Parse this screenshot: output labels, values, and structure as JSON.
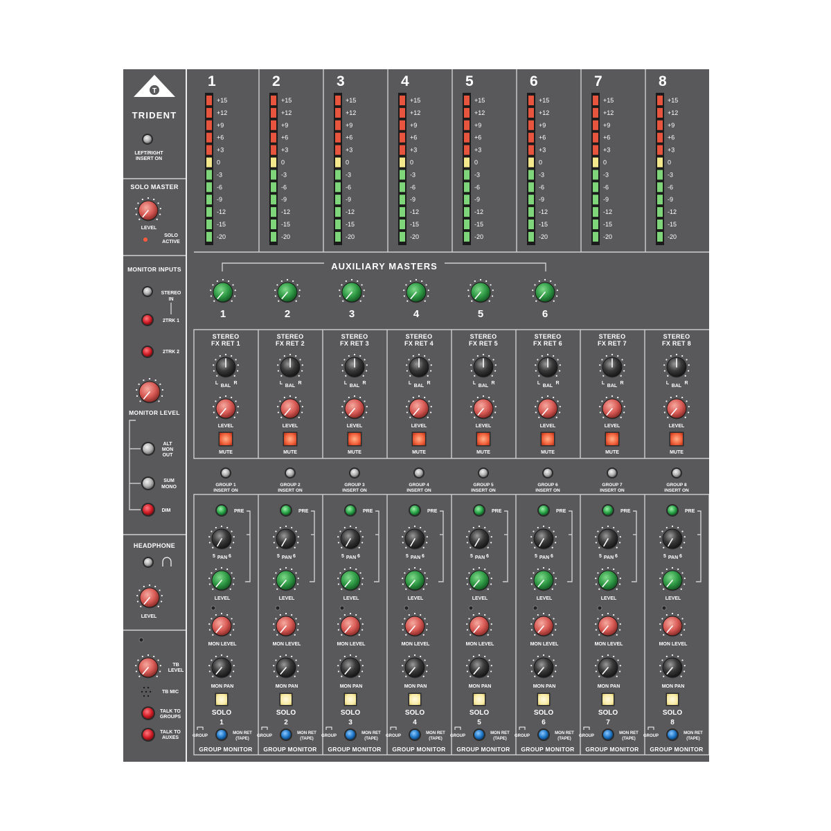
{
  "brand": {
    "name": "TRIDENT"
  },
  "master": {
    "insert_label_1": "LEFT/RIGHT",
    "insert_label_2": "INSERT ON",
    "solo_master": "SOLO MASTER",
    "level": "LEVEL",
    "solo_active_1": "SOLO",
    "solo_active_2": "ACTIVE",
    "monitor_inputs": "MONITOR INPUTS",
    "stereo_in_1": "STEREO",
    "stereo_in_2": "IN",
    "trk1": "2TRK 1",
    "trk2": "2TRK 2",
    "monitor_level": "MONITOR LEVEL",
    "alt_1": "ALT",
    "alt_2": "MON",
    "alt_3": "OUT",
    "sum_1": "SUM",
    "sum_2": "MONO",
    "dim": "DIM",
    "headphone": "HEADPHONE",
    "hp_level": "LEVEL",
    "tb_level_1": "TB",
    "tb_level_2": "LEVEL",
    "tb_mic": "TB MIC",
    "talk_groups_1": "TALK TO",
    "talk_groups_2": "GROUPS",
    "talk_auxes_1": "TALK TO",
    "talk_auxes_2": "AUXES"
  },
  "meters": {
    "scale": [
      "+15",
      "+12",
      "+9",
      "+6",
      "+3",
      "0",
      "-3",
      "-6",
      "-9",
      "-12",
      "-15",
      "-20"
    ],
    "segment_colors": [
      "red",
      "red",
      "red",
      "red",
      "red",
      "yellow",
      "green",
      "green",
      "green",
      "green",
      "green",
      "green"
    ]
  },
  "aux": {
    "title": "AUXILIARY MASTERS",
    "knobs": [
      "1",
      "2",
      "3",
      "4",
      "5",
      "6"
    ]
  },
  "labels": {
    "bal": "BAL",
    "bal_l": "L",
    "bal_r": "R",
    "level": "LEVEL",
    "mute": "MUTE",
    "pre": "PRE",
    "pan": "PAN",
    "mon_level": "MON LEVEL",
    "mon_pan": "MON PAN",
    "solo": "SOLO",
    "group": "GROUP",
    "mon_ret_1": "MON RET",
    "mon_ret_2": "(TAPE)",
    "group_monitor": "GROUP MONITOR",
    "insert_on": "INSERT ON"
  },
  "channels": [
    {
      "num": "1",
      "fx_1": "STEREO",
      "fx_2": "FX RET 1",
      "insert": "GROUP 1",
      "pan_l": "5",
      "pan_r": "6"
    },
    {
      "num": "2",
      "fx_1": "STEREO",
      "fx_2": "FX RET 2",
      "insert": "GROUP 2",
      "pan_l": "5",
      "pan_r": "6"
    },
    {
      "num": "3",
      "fx_1": "STEREO",
      "fx_2": "FX RET 3",
      "insert": "GROUP 3",
      "pan_l": "5",
      "pan_r": "6"
    },
    {
      "num": "4",
      "fx_1": "STEREO",
      "fx_2": "FX RET 4",
      "insert": "GROUP 4",
      "pan_l": "5",
      "pan_r": "6"
    },
    {
      "num": "5",
      "fx_1": "STEREO",
      "fx_2": "FX RET 5",
      "insert": "GROUP 5",
      "pan_l": "5",
      "pan_r": "6"
    },
    {
      "num": "6",
      "fx_1": "STEREO",
      "fx_2": "FX RET 6",
      "insert": "GROUP 6",
      "pan_l": "5",
      "pan_r": "6"
    },
    {
      "num": "7",
      "fx_1": "STEREO",
      "fx_2": "FX RET 7",
      "insert": "GROUP 7",
      "pan_l": "5",
      "pan_r": "6"
    },
    {
      "num": "8",
      "fx_1": "STEREO",
      "fx_2": "FX RET 8",
      "insert": "GROUP 8",
      "pan_l": "5",
      "pan_r": "6"
    }
  ],
  "colors": {
    "panel": "#59595b",
    "panel_dark": "#505052",
    "knob_green": "#2f9a45",
    "knob_red": "#d85a55",
    "knob_black": "#2a2a2a",
    "mute": "#f0603a",
    "solo": "#f7e9a0",
    "meter_red": "#e8553f",
    "meter_yellow": "#f3e88c",
    "meter_green": "#7fd57a",
    "led_red": "#d21e28",
    "button_grey": "#b8b8b8",
    "blue": "#1f78c8"
  }
}
